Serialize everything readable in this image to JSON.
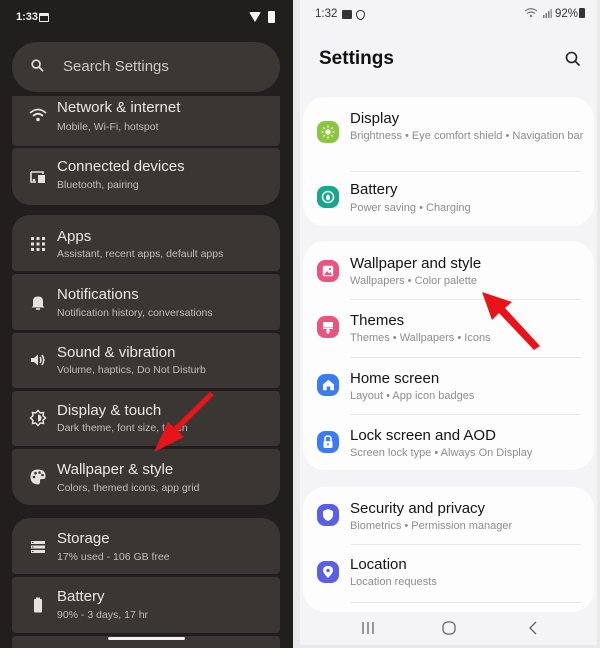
{
  "left_phone": {
    "status_bar": {
      "time": "1:33"
    },
    "search": {
      "placeholder": "Search Settings"
    },
    "items": [
      {
        "title": "Network & internet",
        "subtitle": "Mobile, Wi-Fi, hotspot",
        "icon": "wifi-icon"
      },
      {
        "title": "Connected devices",
        "subtitle": "Bluetooth, pairing",
        "icon": "connected-devices-icon"
      },
      {
        "title": "Apps",
        "subtitle": "Assistant, recent apps, default apps",
        "icon": "apps-grid-icon"
      },
      {
        "title": "Notifications",
        "subtitle": "Notification history, conversations",
        "icon": "bell-icon"
      },
      {
        "title": "Sound & vibration",
        "subtitle": "Volume, haptics, Do Not Disturb",
        "icon": "speaker-icon"
      },
      {
        "title": "Display & touch",
        "subtitle": "Dark theme, font size, touch",
        "icon": "brightness-icon"
      },
      {
        "title": "Wallpaper & style",
        "subtitle": "Colors, themed icons, app grid",
        "icon": "palette-icon"
      },
      {
        "title": "Storage",
        "subtitle": "17% used - 106 GB free",
        "icon": "storage-icon"
      },
      {
        "title": "Battery",
        "subtitle": "90% - 3 days, 17 hr",
        "icon": "battery-icon"
      }
    ]
  },
  "right_phone": {
    "status_bar": {
      "time": "1:32",
      "battery": "92%"
    },
    "title": "Settings",
    "groups": [
      {
        "items": [
          {
            "title": "Display",
            "subtitle": "Brightness  •  Eye comfort shield  •  Navigation bar",
            "icon": "display-icon",
            "color": "#8cc63e"
          },
          {
            "title": "Battery",
            "subtitle": "Power saving  •  Charging",
            "icon": "battery-icon",
            "color": "#1aa58f"
          }
        ]
      },
      {
        "items": [
          {
            "title": "Wallpaper and style",
            "subtitle": "Wallpapers  •  Color palette",
            "icon": "wallpaper-icon",
            "color": "#e9557e"
          },
          {
            "title": "Themes",
            "subtitle": "Themes  •  Wallpapers  •  Icons",
            "icon": "themes-brush-icon",
            "color": "#e9557e"
          },
          {
            "title": "Home screen",
            "subtitle": "Layout  •  App icon badges",
            "icon": "home-icon",
            "color": "#3c7cf3"
          },
          {
            "title": "Lock screen and AOD",
            "subtitle": "Screen lock type  •  Always On Display",
            "icon": "lock-icon",
            "color": "#3c7cf3"
          }
        ]
      },
      {
        "items": [
          {
            "title": "Security and privacy",
            "subtitle": "Biometrics  •  Permission manager",
            "icon": "shield-icon",
            "color": "#5a5fe8"
          },
          {
            "title": "Location",
            "subtitle": "Location requests",
            "icon": "location-pin-icon",
            "color": "#5a5fe8"
          }
        ]
      }
    ]
  },
  "annotation_color": "#e8141a"
}
